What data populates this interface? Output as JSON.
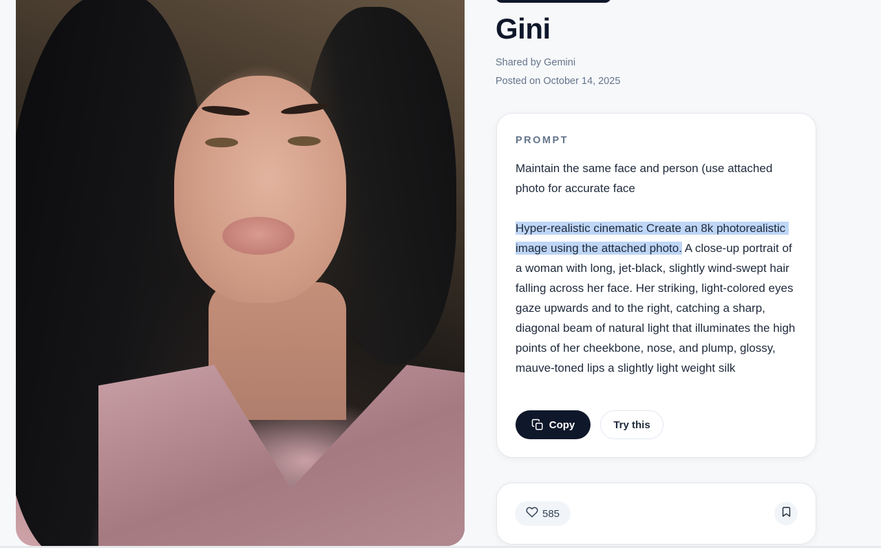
{
  "post": {
    "title": "Gini",
    "shared_by": "Shared by Gemini",
    "posted_on": "Posted on October 14, 2025"
  },
  "prompt": {
    "label": "PROMPT",
    "line1": "Maintain the same face and person (use attached photo for accurate face",
    "highlighted": "Hyper-realistic cinematic Create an 8k photorealistic image using the attached photo.",
    "rest": " A close-up portrait of a woman with long, jet-black, slightly wind-swept hair falling across her face. Her striking, light-colored eyes gaze upwards and to the right, catching a sharp, diagonal beam of natural light that illuminates the high points of her cheekbone, nose, and plump, glossy, mauve-toned lips a slightly light weight silk"
  },
  "actions": {
    "copy_label": "Copy",
    "try_label": "Try this"
  },
  "stats": {
    "likes": "585"
  },
  "icons": {
    "copy": "copy-icon",
    "like": "heart-icon",
    "bookmark": "bookmark-icon"
  },
  "colors": {
    "primary_dark": "#0f172a",
    "muted_text": "#64748b",
    "selection": "#bfd6f6",
    "page_bg": "#f7f8fa"
  }
}
